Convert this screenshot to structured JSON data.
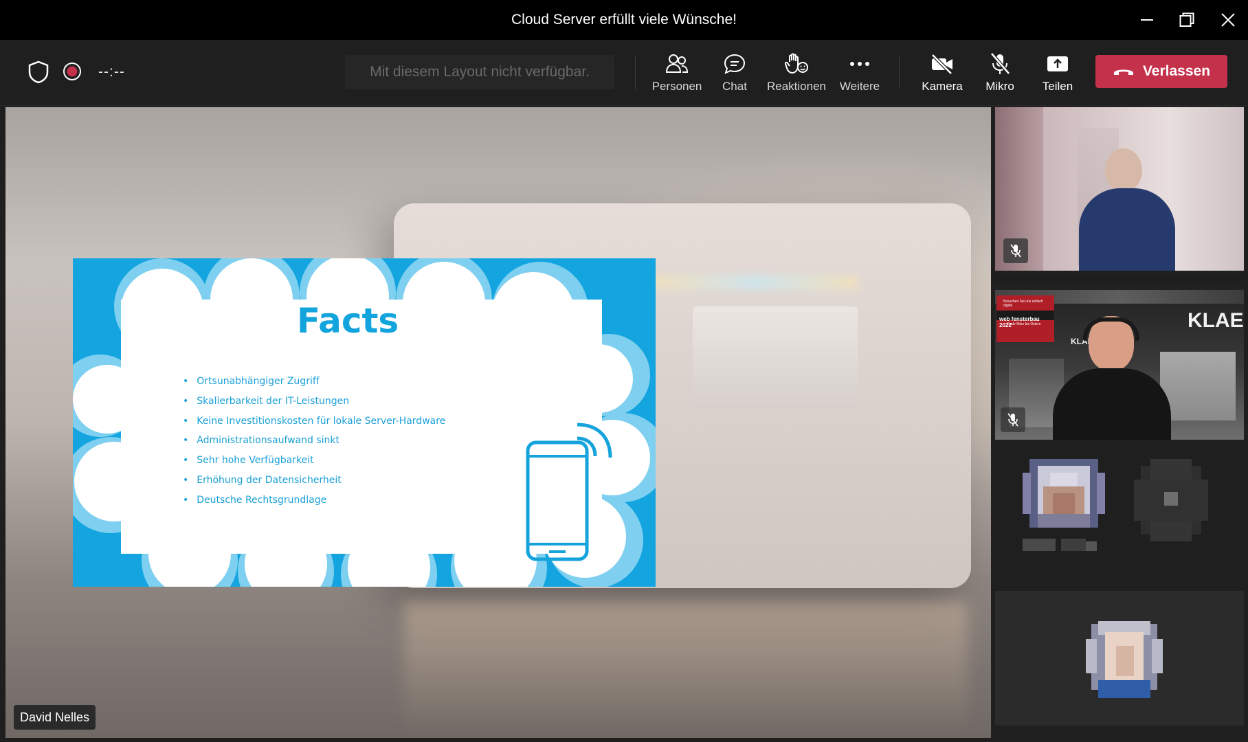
{
  "window": {
    "title": "Cloud Server erfüllt viele Wünsche!"
  },
  "toolbar": {
    "timer": "--:--",
    "layout_message": "Mit diesem Layout nicht verfügbar.",
    "buttons": {
      "people": "Personen",
      "chat": "Chat",
      "reactions": "Reaktionen",
      "more": "Weitere",
      "camera": "Kamera",
      "mic": "Mikro",
      "share": "Teilen"
    },
    "leave": "Verlassen"
  },
  "slide": {
    "title": "Facts",
    "items": [
      "Ortsunabhängiger Zugriff",
      "Skalierbarkeit der IT-Leistungen",
      "Keine Investitionskosten für lokale Server-Hardware",
      "Administrationsaufwand sinkt",
      "Sehr hohe Verfügbarkeit",
      "Erhöhung der Datensicherheit",
      "Deutsche Rechtsgrundlage"
    ]
  },
  "presenter": {
    "name": "David Nelles"
  },
  "participants": {
    "booth_banner_line1": "Besuchen Sie uns einfach digital",
    "booth_banner_line2": "web fensterbau 2022",
    "booth_banner_line3": "Ende März bis Ostern",
    "booth_brand": "KLAES",
    "booth_small_brand": "KLAE"
  },
  "colors": {
    "leave": "#c4314b",
    "slide_blue": "#14a5e0",
    "recording_dot": "#c4314b"
  }
}
